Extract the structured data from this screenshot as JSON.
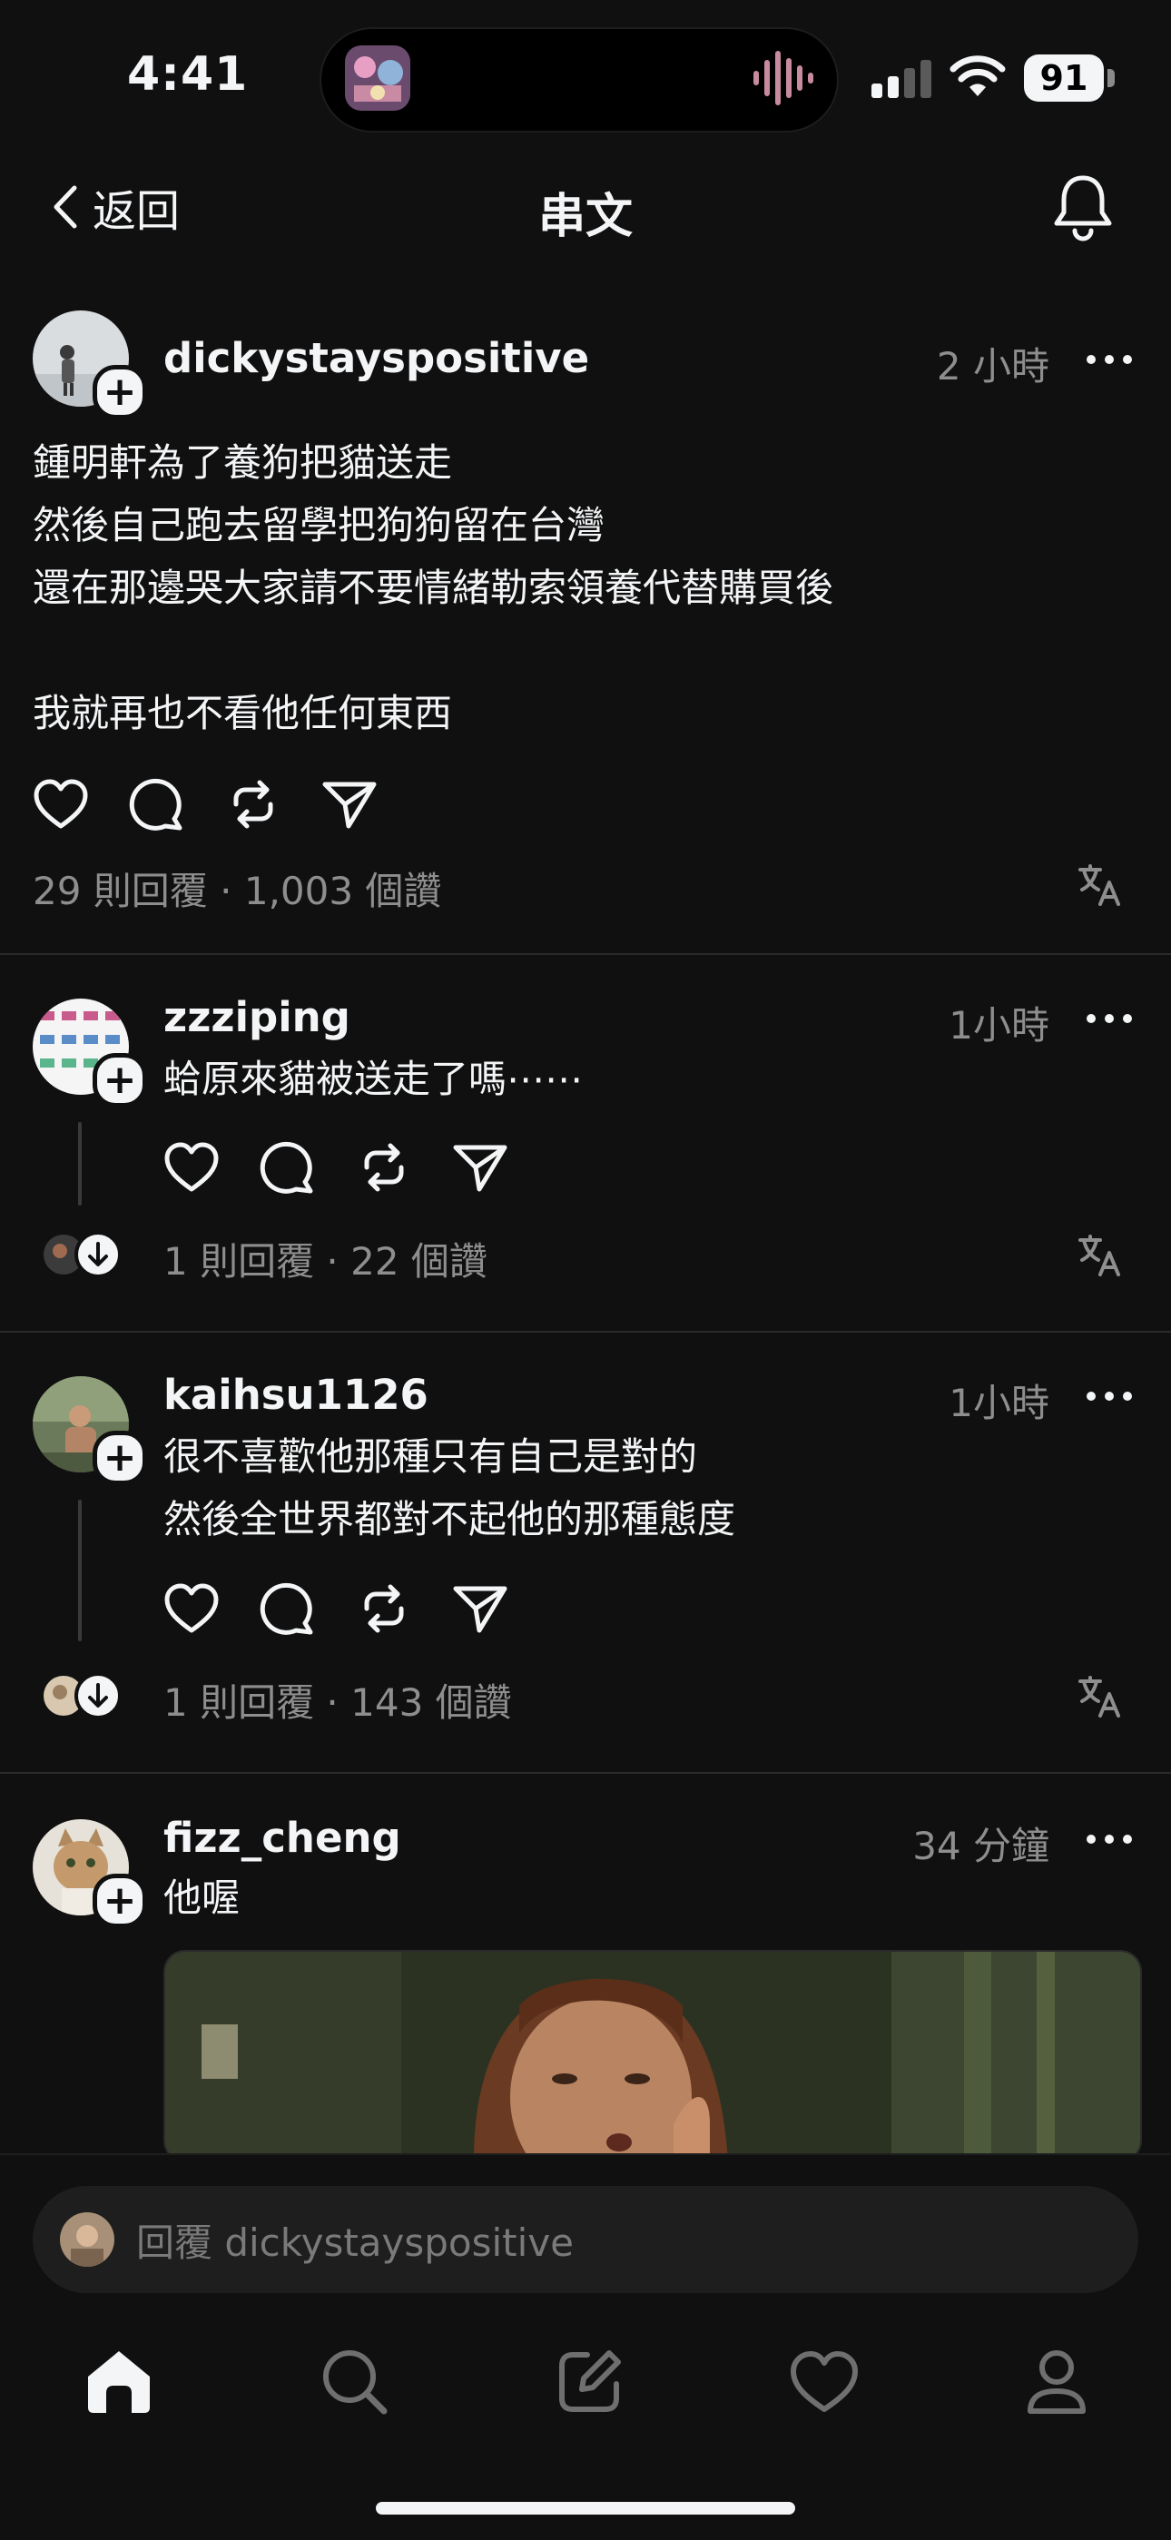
{
  "status_bar": {
    "time": "4:41",
    "battery": "91"
  },
  "nav": {
    "back_label": "返回",
    "title": "串文"
  },
  "main_post": {
    "username": "dickystayspositive",
    "time": "2 小時",
    "text": "鍾明軒為了養狗把貓送走\n然後自己跑去留學把狗狗留在台灣\n還在那邊哭大家請不要情緒勒索領養代替購買後\n\n我就再也不看他任何東西",
    "stats": "29 則回覆 · 1,003 個讚"
  },
  "replies": [
    {
      "username": "zzziping",
      "time": "1小時",
      "text": "蛤原來貓被送走了嗎⋯⋯",
      "stats": "1 則回覆 · 22 個讚"
    },
    {
      "username": "kaihsu1126",
      "time": "1小時",
      "text": "很不喜歡他那種只有自己是對的\n然後全世界都對不起他的那種態度",
      "stats": "1 則回覆 · 143 個讚"
    },
    {
      "username": "fizz_cheng",
      "time": "34 分鐘",
      "text": "他喔"
    }
  ],
  "reply_bar": {
    "placeholder": "回覆 dickystayspositive"
  },
  "tabs": [
    "home-icon",
    "search-icon",
    "compose-icon",
    "activity-heart-icon",
    "profile-icon"
  ],
  "colors": {
    "background": "#101010",
    "text": "#f3f5f7",
    "secondary": "#8e8e8e"
  }
}
